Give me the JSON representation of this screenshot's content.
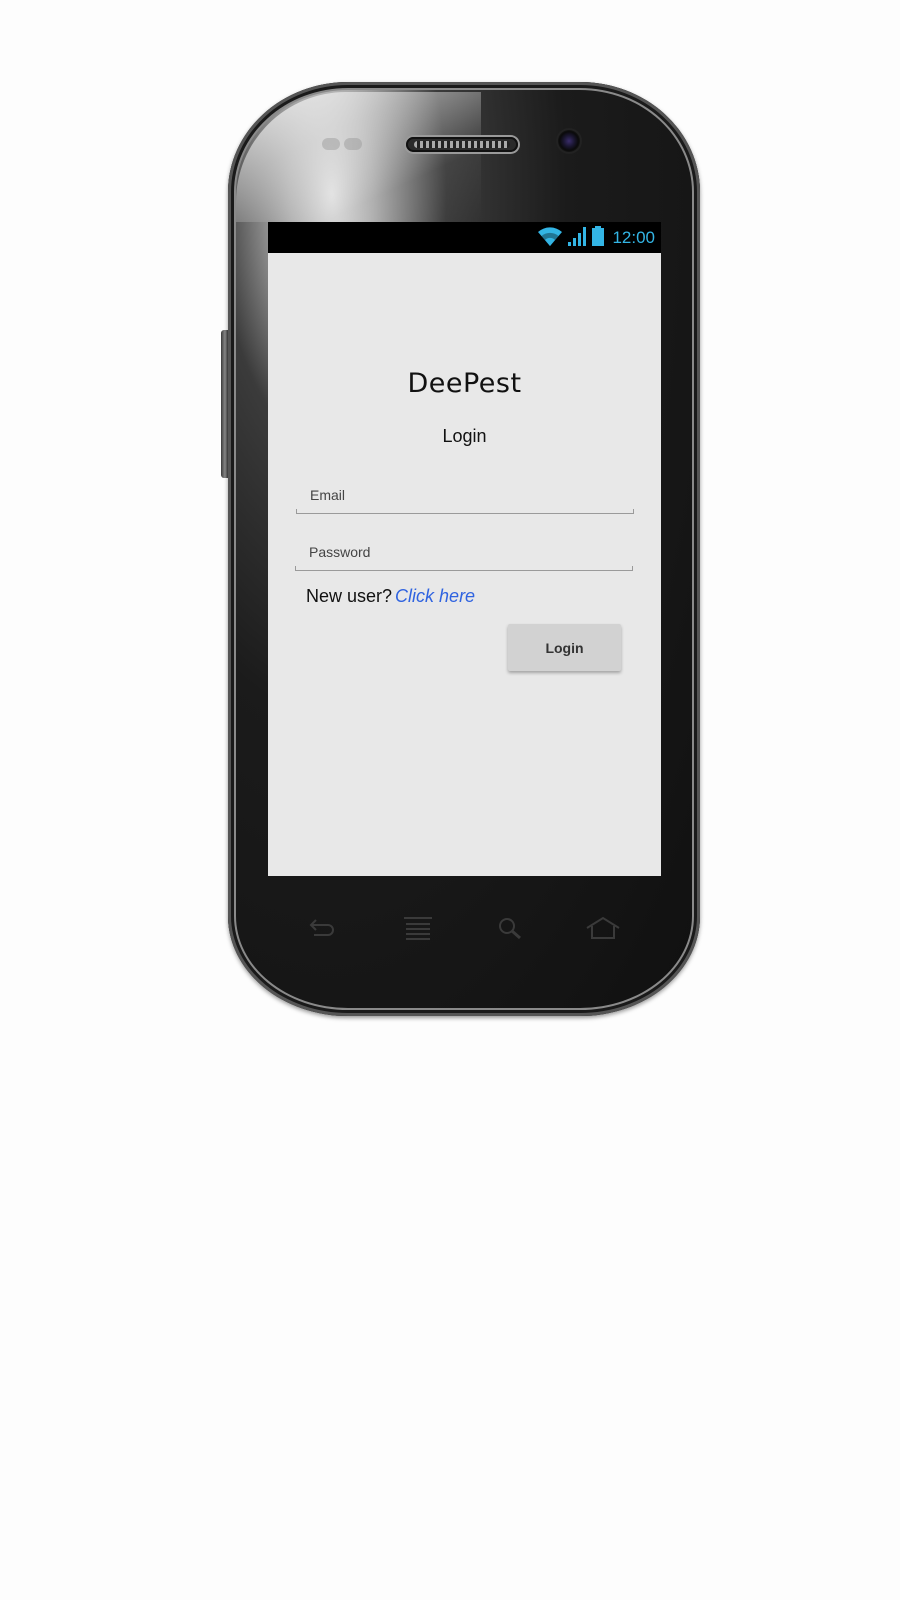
{
  "status_bar": {
    "time": "12:00",
    "icons": [
      "wifi-icon",
      "signal-icon",
      "battery-icon"
    ],
    "accent_color": "#33b5e5"
  },
  "app": {
    "title": "DeePest",
    "subtitle": "Login"
  },
  "form": {
    "email_placeholder": "Email",
    "email_value": "",
    "password_placeholder": "Password",
    "password_value": "",
    "new_user_text": "New user?",
    "new_user_link": "Click here",
    "link_color": "#2f63e0",
    "login_button": "Login"
  },
  "hardware_keys": [
    "back-icon",
    "menu-icon",
    "search-icon",
    "home-icon"
  ]
}
